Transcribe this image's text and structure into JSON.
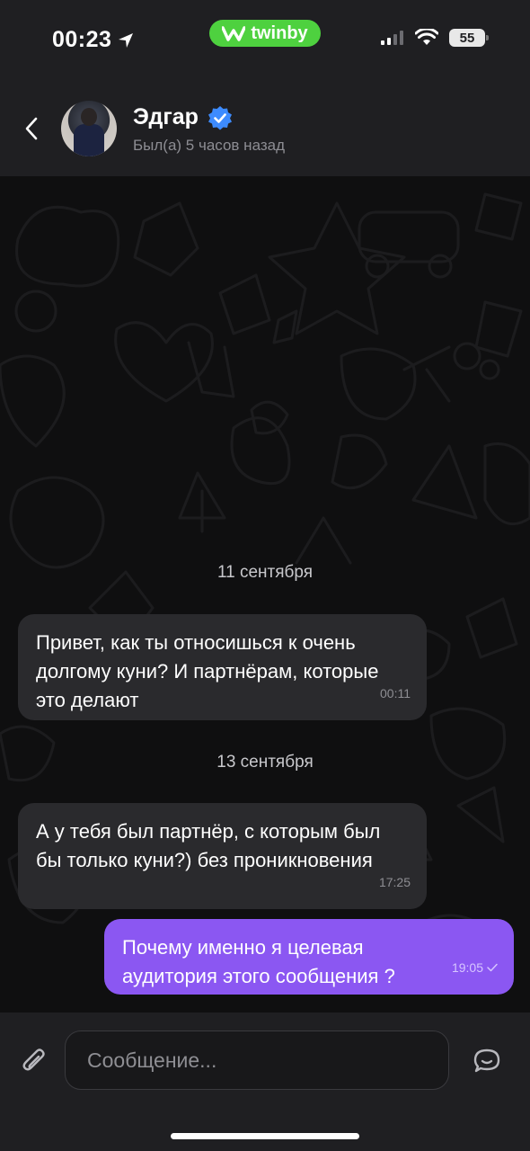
{
  "status_bar": {
    "time": "00:23",
    "app_badge": "twinby",
    "battery": "55",
    "location_icon": "location-arrow-icon",
    "signal_icon": "signal-icon",
    "wifi_icon": "wifi-icon"
  },
  "header": {
    "back_icon": "chevron-left-icon",
    "name": "Эдгар",
    "verified_icon": "verified-badge-icon",
    "status": "Был(а) 5 часов назад"
  },
  "messages": [
    {
      "type": "date",
      "text": "11 сентября"
    },
    {
      "type": "incoming",
      "text": "Привет, как ты относишься к очень долгому куни? И партнёрам, которые это делают",
      "time": "00:11"
    },
    {
      "type": "date",
      "text": "13 сентября"
    },
    {
      "type": "incoming",
      "text": "А у тебя был партнёр, с которым был бы только куни?) без проникновения",
      "time": "17:25"
    },
    {
      "type": "outgoing",
      "text": "Почему именно я целевая аудитория этого сообщения ?",
      "time": "19:05"
    }
  ],
  "input": {
    "placeholder": "Сообщение...",
    "attach_icon": "paperclip-icon",
    "sticker_icon": "chat-bubble-icon"
  },
  "colors": {
    "outgoing_bubble": "#8b57f2",
    "incoming_bubble": "#2a2a2d",
    "badge": "#4ed13f",
    "verified": "#3d8bff"
  }
}
